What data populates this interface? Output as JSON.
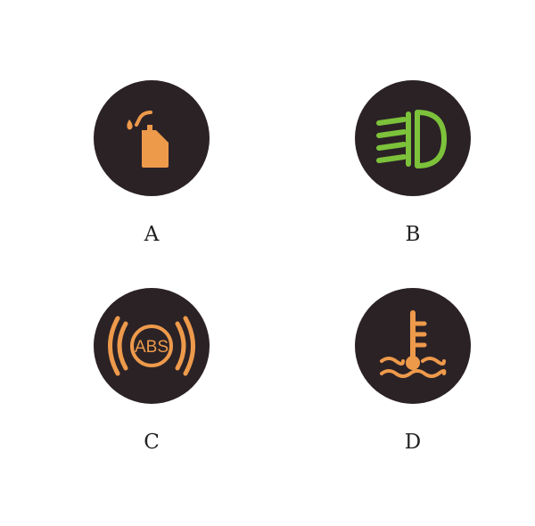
{
  "options": [
    {
      "letter": "A",
      "icon": "oil-can-icon",
      "color": "#ee9a4b"
    },
    {
      "letter": "B",
      "icon": "fog-light-icon",
      "color": "#7cc23a"
    },
    {
      "letter": "C",
      "icon": "abs-warning-icon",
      "color": "#ee9a4b",
      "badge_text": "ABS"
    },
    {
      "letter": "D",
      "icon": "coolant-temperature-icon",
      "color": "#ee9a4b"
    }
  ],
  "badge_color": "#2b2226"
}
